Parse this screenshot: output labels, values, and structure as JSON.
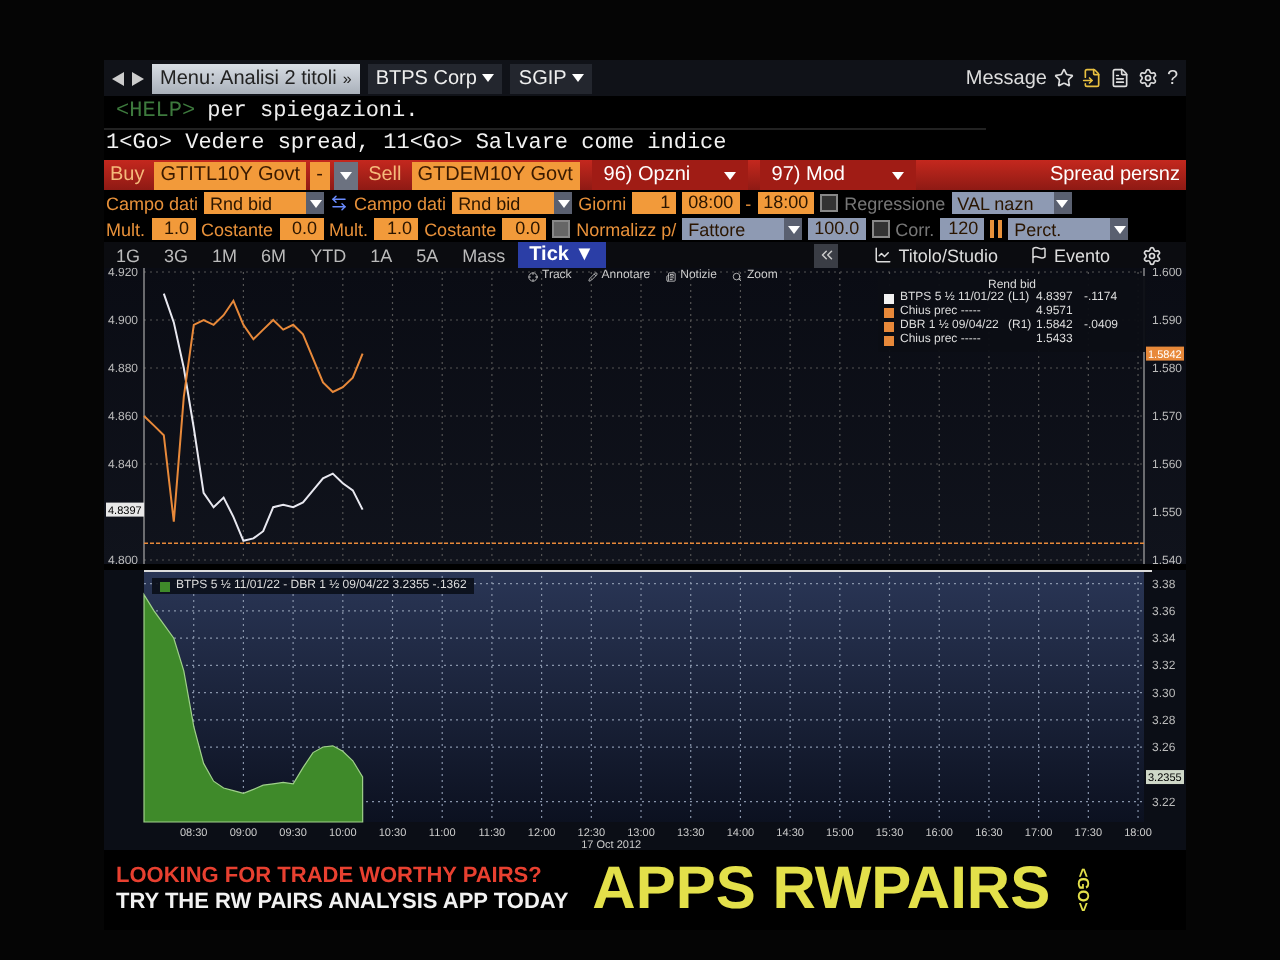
{
  "top_bar": {
    "menu": "Menu: Analisi 2 titoli",
    "menu_caret": "»",
    "tabs": [
      {
        "label": "BTPS Corp"
      },
      {
        "label": "SGIP"
      }
    ],
    "message": "Message",
    "help": "?"
  },
  "command_line": {
    "key": "<HELP>",
    "text": "per spiegazioni."
  },
  "hint": "1<Go> Vedere spread, 11<Go> Salvare come indice",
  "order_bar": {
    "buy_label": "Buy",
    "buy_value": "GTITL10Y Govt",
    "minus": "-",
    "sell_label": "Sell",
    "sell_value": "GTDEM10Y Govt",
    "menus": [
      "96) Opzni",
      "97) Mod"
    ],
    "title": "Spread persnz"
  },
  "settings_rows": [
    {
      "items": [
        {
          "kind": "label",
          "text": "Campo dati"
        },
        {
          "kind": "select",
          "text": "Rnd bid",
          "disabled": false
        },
        {
          "kind": "swap"
        },
        {
          "kind": "label",
          "text": "Campo dati"
        },
        {
          "kind": "select",
          "text": "Rnd bid",
          "disabled": false
        },
        {
          "kind": "label",
          "text": "Giorni"
        },
        {
          "kind": "field",
          "text": "1",
          "disabled": false
        },
        {
          "kind": "field",
          "text": "08:00",
          "disabled": false
        },
        {
          "kind": "label",
          "text": "-"
        },
        {
          "kind": "field",
          "text": "18:00",
          "disabled": false
        },
        {
          "kind": "checkbox",
          "text": "Regressione",
          "checked": false,
          "disabled": true
        },
        {
          "kind": "select",
          "text": "VAL nazn",
          "disabled": true
        }
      ]
    },
    {
      "items": [
        {
          "kind": "label",
          "text": "Mult."
        },
        {
          "kind": "field",
          "text": "1.0",
          "disabled": false
        },
        {
          "kind": "label",
          "text": "Costante"
        },
        {
          "kind": "field",
          "text": "0.0",
          "disabled": false
        },
        {
          "kind": "label",
          "text": "Mult."
        },
        {
          "kind": "field",
          "text": "1.0",
          "disabled": false
        },
        {
          "kind": "label",
          "text": "Costante"
        },
        {
          "kind": "field",
          "text": "0.0",
          "disabled": false
        },
        {
          "kind": "checkbox",
          "text": "Normalizz p/",
          "checked": false,
          "disabled": false
        },
        {
          "kind": "select",
          "text": "Fattore",
          "disabled": true
        },
        {
          "kind": "field",
          "text": "100.0",
          "disabled": true
        },
        {
          "kind": "checkbox",
          "text": "Corr.",
          "checked": false,
          "disabled": true
        },
        {
          "kind": "field",
          "text": "120",
          "disabled": true
        },
        {
          "kind": "bars"
        },
        {
          "kind": "select",
          "text": "Perct.",
          "disabled": true
        }
      ]
    }
  ],
  "periods": [
    {
      "label": "1G",
      "selected": false
    },
    {
      "label": "3G",
      "selected": false
    },
    {
      "label": "1M",
      "selected": false
    },
    {
      "label": "6M",
      "selected": false
    },
    {
      "label": "YTD",
      "selected": false
    },
    {
      "label": "1A",
      "selected": false
    },
    {
      "label": "5A",
      "selected": false
    },
    {
      "label": "Mass",
      "selected": false
    },
    {
      "label": "Tick ▼",
      "selected": true
    }
  ],
  "chart_tools": [
    "Titolo/Studio",
    "Evento"
  ],
  "upper_chart": {
    "toolbar": [
      "Track",
      "Annotare",
      "Notizie",
      "Zoom"
    ],
    "legend": {
      "title": "Rend bid",
      "rows": [
        {
          "name": "BTPS 5 ½ 11/01/22",
          "axis": "(L1)",
          "value": "4.8397",
          "change": "-.1174",
          "color": "#f2f2f2"
        },
        {
          "name": "Chius prec -----",
          "value": "4.9571",
          "color": "#e8893a"
        },
        {
          "name": "DBR 1 ½ 09/04/22",
          "axis": "(R1)",
          "value": "1.5842",
          "change": "-.0409",
          "color": "#e8893a"
        },
        {
          "name": "Chius prec -----",
          "value": "1.5433",
          "color": "#e8893a"
        }
      ]
    },
    "tags": [
      {
        "text": "4.8397"
      },
      {
        "text": "1.5842"
      }
    ],
    "chart_data": {
      "type": "line",
      "grid": true,
      "x": [
        8.0,
        8.1,
        8.2,
        8.3,
        8.4,
        8.5,
        8.6,
        8.7,
        8.8,
        8.9,
        9.0,
        9.1,
        9.2,
        9.3,
        9.4,
        9.5,
        9.6,
        9.7,
        9.8,
        9.9,
        10.0,
        10.1,
        10.2,
        18.06
      ],
      "series": [
        {
          "color": "#e8e8f0",
          "values": [
            null,
            null,
            4.911,
            4.899,
            4.88,
            4.855,
            4.828,
            4.822,
            4.826,
            4.818,
            4.808,
            4.809,
            4.812,
            4.822,
            4.823,
            4.822,
            4.824,
            4.829,
            4.834,
            4.836,
            4.832,
            4.829,
            4.821,
            null
          ]
        },
        {
          "color": "#e8893a",
          "axis": "y2",
          "values": [
            1.57,
            1.568,
            1.566,
            1.548,
            1.574,
            1.589,
            1.59,
            1.589,
            1.591,
            1.594,
            1.589,
            1.586,
            1.588,
            1.59,
            1.588,
            1.589,
            1.587,
            1.582,
            1.577,
            1.575,
            1.576,
            1.578,
            1.583,
            null
          ]
        },
        {
          "color": "#e8893a",
          "line_style": "dashed",
          "values": [
            4.807,
            4.807,
            4.807,
            4.807,
            4.807,
            4.807,
            4.807,
            4.807,
            4.807,
            4.807,
            4.807,
            4.807,
            4.807,
            4.807,
            4.807,
            4.807,
            4.807,
            4.807,
            4.807,
            4.807,
            4.807,
            4.807,
            4.807,
            4.807
          ]
        }
      ],
      "xlim": [
        8,
        18.06
      ],
      "ylim": [
        4.8,
        4.92
      ],
      "y2lim": [
        1.54,
        1.6
      ],
      "yticks": [
        {
          "value": 4.92,
          "label": "4.920"
        },
        {
          "value": 4.9,
          "label": "4.900"
        },
        {
          "value": 4.88,
          "label": "4.880"
        },
        {
          "value": 4.86,
          "label": "4.860"
        },
        {
          "value": 4.84,
          "label": "4.840"
        },
        {
          "value": 4.8,
          "label": "4.800"
        }
      ],
      "y2ticks": [
        {
          "value": 1.6,
          "label": "1.600"
        },
        {
          "value": 1.59,
          "label": "1.590"
        },
        {
          "value": 1.58,
          "label": "1.580"
        },
        {
          "value": 1.57,
          "label": "1.570"
        },
        {
          "value": 1.56,
          "label": "1.560"
        },
        {
          "value": 1.55,
          "label": "1.550"
        },
        {
          "value": 1.54,
          "label": "1.540"
        }
      ]
    }
  },
  "lower_chart": {
    "legend": "BTPS 5 ½ 11/01/22 - DBR 1 ½ 09/04/22 3.2355  -.1362",
    "tags": [
      {
        "text": "3.2355"
      }
    ],
    "chart_data": {
      "type": "area",
      "grid": true,
      "xlabel": "17 Oct 2012",
      "x": [
        8.0,
        8.1,
        8.2,
        8.3,
        8.4,
        8.5,
        8.6,
        8.7,
        8.8,
        8.9,
        9.0,
        9.1,
        9.2,
        9.3,
        9.4,
        9.5,
        9.6,
        9.7,
        9.8,
        9.9,
        10.0,
        10.1,
        10.2
      ],
      "series": [
        {
          "color": "#3f8a2a",
          "values": [
            3.372,
            3.36,
            3.35,
            3.34,
            3.316,
            3.275,
            3.248,
            3.235,
            3.23,
            3.228,
            3.226,
            3.229,
            3.232,
            3.233,
            3.234,
            3.233,
            3.245,
            3.256,
            3.26,
            3.261,
            3.257,
            3.25,
            3.238
          ]
        }
      ],
      "xlim": [
        8,
        18.06
      ],
      "ylim": [
        3.205,
        3.39
      ],
      "xticks": [
        {
          "value": 8.5,
          "label": "08:30"
        },
        {
          "value": 9,
          "label": "09:00"
        },
        {
          "value": 9.5,
          "label": "09:30"
        },
        {
          "value": 10,
          "label": "10:00"
        },
        {
          "value": 10.5,
          "label": "10:30"
        },
        {
          "value": 11,
          "label": "11:00"
        },
        {
          "value": 11.5,
          "label": "11:30"
        },
        {
          "value": 12,
          "label": "12:00"
        },
        {
          "value": 12.5,
          "label": "12:30"
        },
        {
          "value": 13,
          "label": "13:00"
        },
        {
          "value": 13.5,
          "label": "13:30"
        },
        {
          "value": 14,
          "label": "14:00"
        },
        {
          "value": 14.5,
          "label": "14:30"
        },
        {
          "value": 15,
          "label": "15:00"
        },
        {
          "value": 15.5,
          "label": "15:30"
        },
        {
          "value": 16,
          "label": "16:00"
        },
        {
          "value": 16.5,
          "label": "16:30"
        },
        {
          "value": 17,
          "label": "17:00"
        },
        {
          "value": 17.5,
          "label": "17:30"
        },
        {
          "value": 18,
          "label": "18:00"
        }
      ],
      "yticks": [
        {
          "value": 3.38,
          "label": "3.38"
        },
        {
          "value": 3.36,
          "label": "3.36"
        },
        {
          "value": 3.34,
          "label": "3.34"
        },
        {
          "value": 3.32,
          "label": "3.32"
        },
        {
          "value": 3.3,
          "label": "3.30"
        },
        {
          "value": 3.28,
          "label": "3.28"
        },
        {
          "value": 3.26,
          "label": "3.26"
        },
        {
          "value": 3.22,
          "label": "3.22"
        }
      ]
    }
  },
  "banner": {
    "headline": "LOOKING FOR TRADE WORTHY PAIRS?",
    "subline": "TRY THE RW PAIRS ANALYSIS APP TODAY",
    "app": "APPS RWPAIRS",
    "go": "<GO>"
  }
}
